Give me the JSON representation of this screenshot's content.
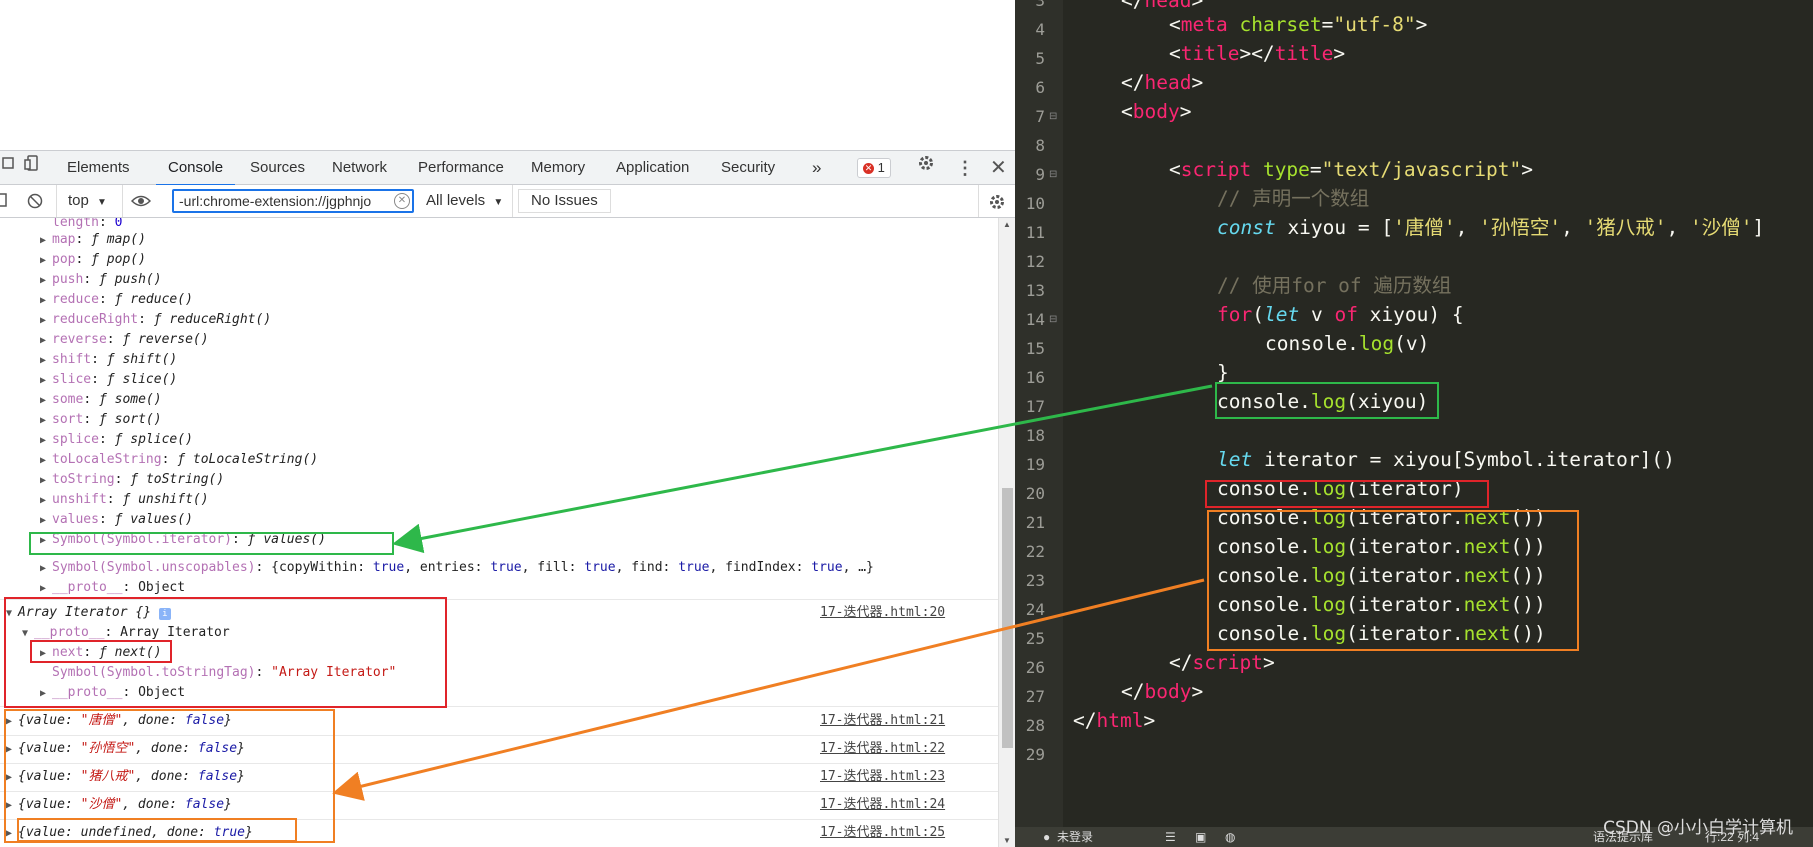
{
  "devtools": {
    "tabs": [
      "Elements",
      "Console",
      "Sources",
      "Network",
      "Performance",
      "Memory",
      "Application",
      "Security"
    ],
    "active_tab": "Console",
    "more_tabs": "»",
    "error_count": "1",
    "toolbar": {
      "context": "top",
      "filter_value": "-url:chrome-extension://jgphnjo",
      "levels": "All levels",
      "issues": "No Issues"
    },
    "console": {
      "length_line": {
        "key": "length",
        "value": "0"
      },
      "methods": [
        {
          "key": "map",
          "fn": "map()"
        },
        {
          "key": "pop",
          "fn": "pop()"
        },
        {
          "key": "push",
          "fn": "push()"
        },
        {
          "key": "reduce",
          "fn": "reduce()"
        },
        {
          "key": "reduceRight",
          "fn": "reduceRight()"
        },
        {
          "key": "reverse",
          "fn": "reverse()"
        },
        {
          "key": "shift",
          "fn": "shift()"
        },
        {
          "key": "slice",
          "fn": "slice()"
        },
        {
          "key": "some",
          "fn": "some()"
        },
        {
          "key": "sort",
          "fn": "sort()"
        },
        {
          "key": "splice",
          "fn": "splice()"
        },
        {
          "key": "toLocaleString",
          "fn": "toLocaleString()"
        },
        {
          "key": "toString",
          "fn": "toString()"
        },
        {
          "key": "unshift",
          "fn": "unshift()"
        },
        {
          "key": "values",
          "fn": "values()"
        },
        {
          "key": "Symbol(Symbol.iterator)",
          "fn": "values()"
        }
      ],
      "unscopables": {
        "key": "Symbol(Symbol.unscopables)",
        "v1": "{copyWithin: ",
        "b1": "true",
        "v2": ", entries: ",
        "b2": "true",
        "v3": ", fill: ",
        "b3": "true",
        "v4": ", find: ",
        "b4": "true",
        "v5": ", findIndex: ",
        "b5": "true",
        "v6": ", …}"
      },
      "proto1": {
        "key": "__proto__",
        "value": ": Object"
      },
      "iterator_header": "Array Iterator {}",
      "iterator_src": "17-迭代器.html:20",
      "iterator_proto": {
        "key": "__proto__",
        "value": ": Array Iterator"
      },
      "next_line": {
        "key": "next",
        "fn": "next()"
      },
      "tostringtag": {
        "key": "Symbol(Symbol.toStringTag)",
        "value": "\"Array Iterator\""
      },
      "proto2": {
        "key": "__proto__",
        "value": ": Object"
      },
      "results": [
        {
          "value": "\"唐僧\"",
          "done": "false",
          "src": "17-迭代器.html:21"
        },
        {
          "value": "\"孙悟空\"",
          "done": "false",
          "src": "17-迭代器.html:22"
        },
        {
          "value": "\"猪八戒\"",
          "done": "false",
          "src": "17-迭代器.html:23"
        },
        {
          "value": "\"沙僧\"",
          "done": "false",
          "src": "17-迭代器.html:24"
        },
        {
          "value": "undefined",
          "done": "true",
          "src": "17-迭代器.html:25"
        }
      ]
    }
  },
  "editor": {
    "line_numbers": [
      "3",
      "4",
      "5",
      "6",
      "7",
      "8",
      "9",
      "10",
      "11",
      "12",
      "13",
      "14",
      "15",
      "16",
      "17",
      "18",
      "19",
      "20",
      "21",
      "22",
      "23",
      "24",
      "25",
      "26",
      "27",
      "28",
      "29"
    ],
    "code": {
      "l4_meta": "meta",
      "l4_attr": "charset",
      "l4_val": "\"utf-8\"",
      "l5_title": "title",
      "l6_head": "head",
      "l7_body": "body",
      "l9_script": "script",
      "l9_attr": "type",
      "l9_val": "\"text/javascript\"",
      "l10_comment": "// 声明一个数组",
      "l11_const": "const",
      "l11_rest": " xiyou = [",
      "l11_s1": "'唐僧'",
      "l11_s2": "'孙悟空'",
      "l11_s3": "'猪八戒'",
      "l11_s4": "'沙僧'",
      "l13_comment": "// 使用for of 遍历数组",
      "l14_for": "for",
      "l14_let": "let",
      "l14_of": "of",
      "l15_console": "console.",
      "l15_log": "log",
      "l15_args": "(v)",
      "l17_args": "(xiyou)",
      "l19_let": "let",
      "l19_rest": " iterator = xiyou[Symbol.iterator]()",
      "l20_args": "(iterator)",
      "l21_args_a": "(iterator.",
      "l21_next": "next",
      "l21_args_b": "())",
      "l26_script": "script",
      "l27_body": "body",
      "l28_html": "html"
    },
    "status": {
      "login": "未登录",
      "hint": "语法提示库",
      "position": "行:22  列:4"
    },
    "watermark": "CSDN @小小白学计算机"
  },
  "colors": {
    "green_box": "#2eb84a",
    "red_box": "#e0242a",
    "orange_box": "#f07f23",
    "accent": "#1a73e8"
  }
}
